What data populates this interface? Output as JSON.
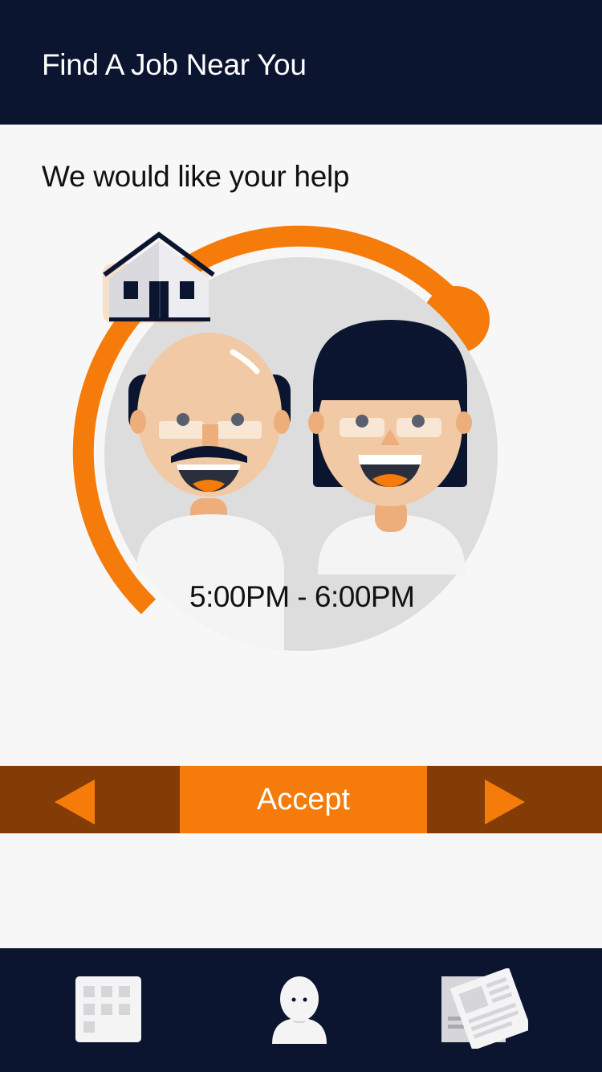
{
  "header": {
    "title": "Find A Job Near You"
  },
  "content": {
    "subtitle": "We would like your help",
    "time_slot": "5:00PM - 6:00PM",
    "illustration": [
      "house-icon",
      "elderly-man-avatar",
      "elderly-woman-avatar"
    ]
  },
  "actions": {
    "prev_icon": "triangle-left-icon",
    "accept_label": "Accept",
    "next_icon": "triangle-right-icon"
  },
  "tabbar": {
    "tabs": [
      {
        "icon": "calendar-icon"
      },
      {
        "icon": "profile-icon"
      },
      {
        "icon": "newspaper-icon"
      }
    ]
  },
  "colors": {
    "navy": "#0c1530",
    "orange": "#f57b0a",
    "dark_orange": "#833c06",
    "background": "#f7f7f7",
    "circle": "#dddddd"
  }
}
